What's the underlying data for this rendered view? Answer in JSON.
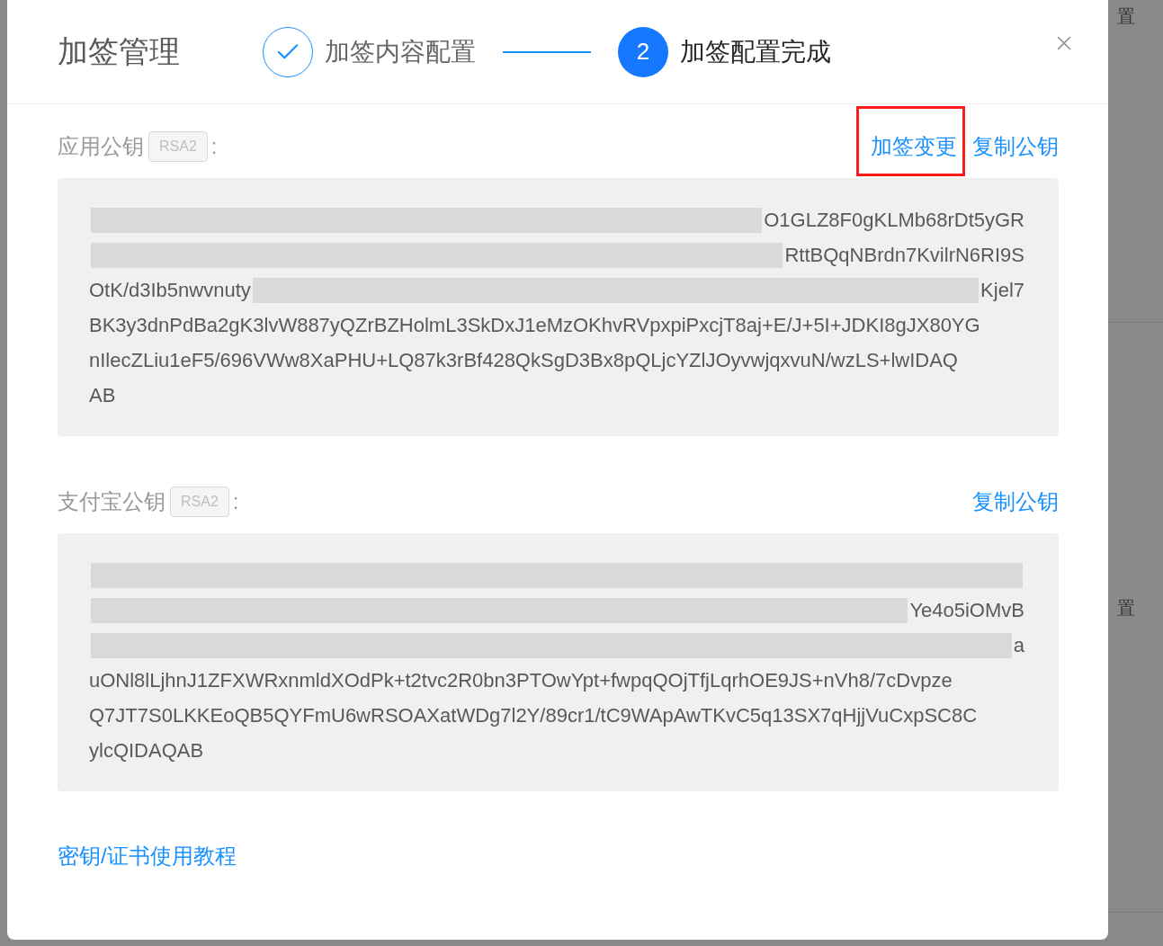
{
  "background_page": {
    "texts": [
      "置",
      "置"
    ]
  },
  "modal": {
    "title": "加签管理",
    "steps": [
      {
        "label": "加签内容配置",
        "done": true,
        "selected": false
      },
      {
        "label": "加签配置完成",
        "done": false,
        "selected": true,
        "number": "2"
      }
    ]
  },
  "sections": [
    {
      "label": "应用公钥",
      "tag": "RSA2",
      "label_suffix": ":",
      "actions": [
        {
          "label": "加签变更",
          "highlighted": true
        },
        {
          "label": "复制公钥",
          "highlighted": false
        }
      ],
      "key_lines": [
        [
          {
            "kind": "redacted"
          },
          {
            "kind": "text",
            "text": "O1GLZ8F0gKLMb68rDt5yGR"
          }
        ],
        [
          {
            "kind": "redacted"
          },
          {
            "kind": "text",
            "text": "RttBQqNBrdn7KvilrN6RI9S"
          }
        ],
        [
          {
            "kind": "text",
            "text": "OtK/d3Ib5nwvnuty"
          },
          {
            "kind": "redacted"
          },
          {
            "kind": "text",
            "text": "Kjel7"
          }
        ],
        [
          {
            "kind": "text",
            "text": "BK3y3dnPdBa2gK3lvW887yQZrBZHolmL3SkDxJ1eMzOKhvRVpxpiPxcjT8aj+E/J+5I+JDKI8gJX80YG"
          }
        ],
        [
          {
            "kind": "text",
            "text": "nIlecZLiu1eF5/696VWw8XaPHU+LQ87k3rBf428QkSgD3Bx8pQLjcYZlJOyvwjqxvuN/wzLS+lwIDAQ"
          }
        ],
        [
          {
            "kind": "text",
            "text": "AB"
          }
        ]
      ]
    },
    {
      "label": "支付宝公钥",
      "tag": "RSA2",
      "label_suffix": ":",
      "actions": [
        {
          "label": "复制公钥",
          "highlighted": false
        }
      ],
      "key_lines": [
        [
          {
            "kind": "redacted"
          }
        ],
        [
          {
            "kind": "redacted"
          },
          {
            "kind": "text",
            "text": "Ye4o5iOMvB"
          }
        ],
        [
          {
            "kind": "redacted"
          },
          {
            "kind": "text",
            "text": "a"
          }
        ],
        [
          {
            "kind": "text",
            "text": "uONl8lLjhnJ1ZFXWRxnmldXOdPk+t2tvc2R0bn3PTOwYpt+fwpqQOjTfjLqrhOE9JS+nVh8/7cDvpze"
          }
        ],
        [
          {
            "kind": "text",
            "text": "Q7JT7S0LKKEoQB5QYFmU6wRSOAXatWDg7l2Y/89cr1/tC9WApAwTKvC5q13SX7qHjjVuCxpSC8C"
          }
        ],
        [
          {
            "kind": "text",
            "text": "ylcQIDAQAB"
          }
        ]
      ]
    }
  ],
  "footer_link": "密钥/证书使用教程"
}
